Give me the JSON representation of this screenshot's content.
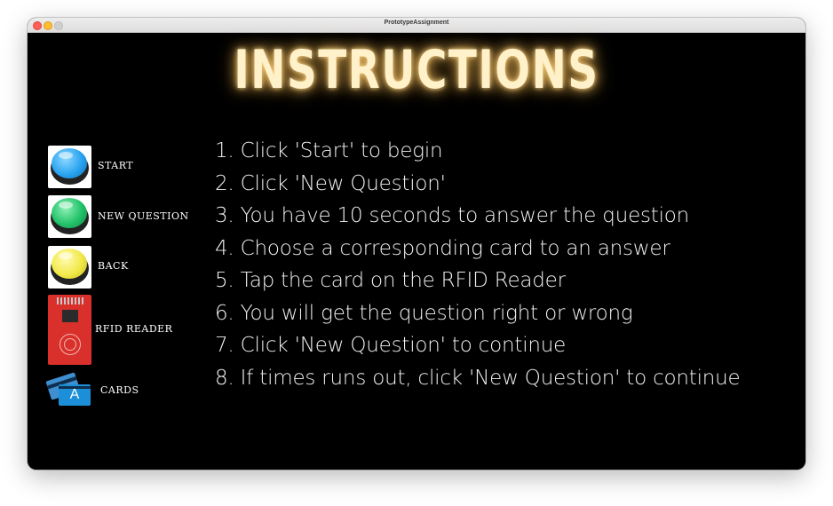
{
  "window": {
    "title": "PrototypeAssignment"
  },
  "heading": "INSTRUCTIONS",
  "legend": [
    {
      "label": "START",
      "icon": "blue-button-icon",
      "color": "#2aa4f0"
    },
    {
      "label": "NEW QUESTION",
      "icon": "green-button-icon",
      "color": "#22c26a"
    },
    {
      "label": "BACK",
      "icon": "yellow-button-icon",
      "color": "#f2e94a"
    },
    {
      "label": "RFID READER",
      "icon": "rfid-reader-icon",
      "color": "#d9302b"
    },
    {
      "label": "CARDS",
      "icon": "cards-icon",
      "card_letter": "A",
      "color": "#1d8fd9"
    }
  ],
  "instructions": [
    "1. Click 'Start' to begin",
    "2. Click 'New Question'",
    "3. You have 10 seconds to answer the question",
    "4. Choose a corresponding card to an answer",
    "5. Tap the card on the RFID Reader",
    "6. You will get the question right or wrong",
    "7. Click 'New Question' to continue",
    "8. If times runs out, click 'New Question' to continue"
  ],
  "colors": {
    "heading_glow": "#e8b45a",
    "background": "#000000",
    "text": "#f2f2f2"
  }
}
